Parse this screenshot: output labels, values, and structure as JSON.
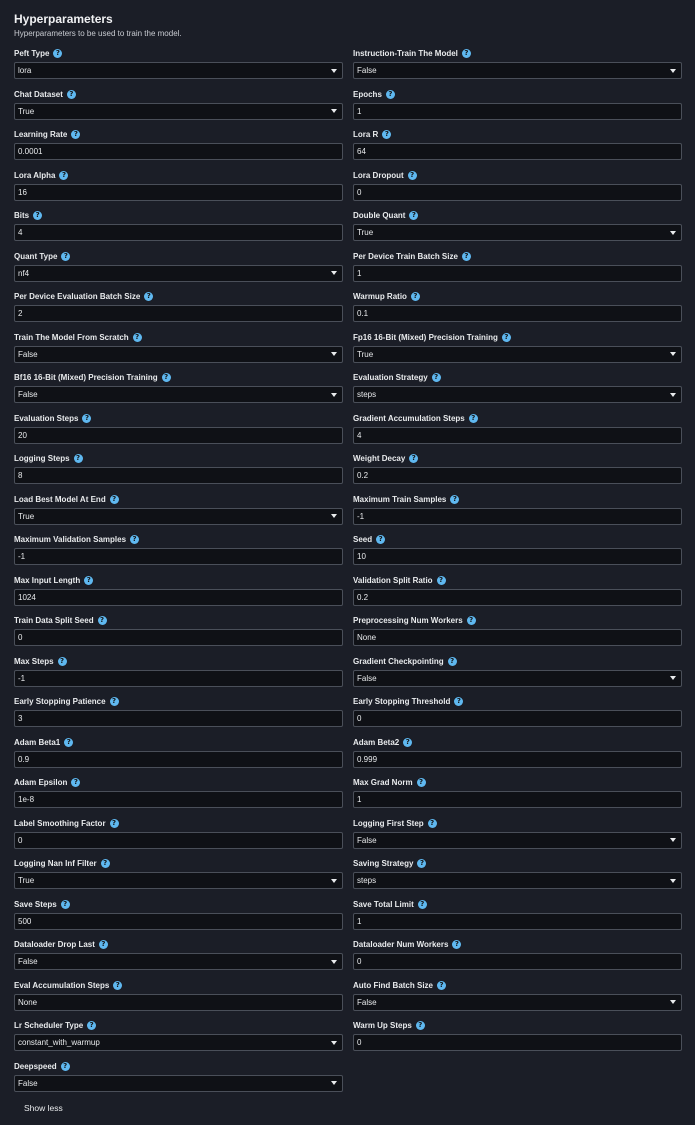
{
  "header": {
    "title": "Hyperparameters",
    "subtitle": "Hyperparameters to be used to train the model."
  },
  "fields": [
    {
      "label": "Peft Type",
      "value": "lora",
      "type": "select"
    },
    {
      "label": "Instruction-Train The Model",
      "value": "False",
      "type": "select"
    },
    {
      "label": "Chat Dataset",
      "value": "True",
      "type": "select"
    },
    {
      "label": "Epochs",
      "value": "1",
      "type": "input"
    },
    {
      "label": "Learning Rate",
      "value": "0.0001",
      "type": "input"
    },
    {
      "label": "Lora R",
      "value": "64",
      "type": "input"
    },
    {
      "label": "Lora Alpha",
      "value": "16",
      "type": "input"
    },
    {
      "label": "Lora Dropout",
      "value": "0",
      "type": "input"
    },
    {
      "label": "Bits",
      "value": "4",
      "type": "input"
    },
    {
      "label": "Double Quant",
      "value": "True",
      "type": "select"
    },
    {
      "label": "Quant Type",
      "value": "nf4",
      "type": "select"
    },
    {
      "label": "Per Device Train Batch Size",
      "value": "1",
      "type": "input"
    },
    {
      "label": "Per Device Evaluation Batch Size",
      "value": "2",
      "type": "input"
    },
    {
      "label": "Warmup Ratio",
      "value": "0.1",
      "type": "input"
    },
    {
      "label": "Train The Model From Scratch",
      "value": "False",
      "type": "select"
    },
    {
      "label": "Fp16 16-Bit (Mixed) Precision Training",
      "value": "True",
      "type": "select"
    },
    {
      "label": "Bf16 16-Bit (Mixed) Precision Training",
      "value": "False",
      "type": "select"
    },
    {
      "label": "Evaluation Strategy",
      "value": "steps",
      "type": "select"
    },
    {
      "label": "Evaluation Steps",
      "value": "20",
      "type": "input"
    },
    {
      "label": "Gradient Accumulation Steps",
      "value": "4",
      "type": "input"
    },
    {
      "label": "Logging Steps",
      "value": "8",
      "type": "input"
    },
    {
      "label": "Weight Decay",
      "value": "0.2",
      "type": "input"
    },
    {
      "label": "Load Best Model At End",
      "value": "True",
      "type": "select"
    },
    {
      "label": "Maximum Train Samples",
      "value": "-1",
      "type": "input"
    },
    {
      "label": "Maximum Validation Samples",
      "value": "-1",
      "type": "input"
    },
    {
      "label": "Seed",
      "value": "10",
      "type": "input"
    },
    {
      "label": "Max Input Length",
      "value": "1024",
      "type": "input"
    },
    {
      "label": "Validation Split Ratio",
      "value": "0.2",
      "type": "input"
    },
    {
      "label": "Train Data Split Seed",
      "value": "0",
      "type": "input"
    },
    {
      "label": "Preprocessing Num Workers",
      "value": "None",
      "type": "input"
    },
    {
      "label": "Max Steps",
      "value": "-1",
      "type": "input"
    },
    {
      "label": "Gradient Checkpointing",
      "value": "False",
      "type": "select"
    },
    {
      "label": "Early Stopping Patience",
      "value": "3",
      "type": "input"
    },
    {
      "label": "Early Stopping Threshold",
      "value": "0",
      "type": "input"
    },
    {
      "label": "Adam Beta1",
      "value": "0.9",
      "type": "input"
    },
    {
      "label": "Adam Beta2",
      "value": "0.999",
      "type": "input"
    },
    {
      "label": "Adam Epsilon",
      "value": "1e-8",
      "type": "input"
    },
    {
      "label": "Max Grad Norm",
      "value": "1",
      "type": "input"
    },
    {
      "label": "Label Smoothing Factor",
      "value": "0",
      "type": "input"
    },
    {
      "label": "Logging First Step",
      "value": "False",
      "type": "select"
    },
    {
      "label": "Logging Nan Inf Filter",
      "value": "True",
      "type": "select"
    },
    {
      "label": "Saving Strategy",
      "value": "steps",
      "type": "select"
    },
    {
      "label": "Save Steps",
      "value": "500",
      "type": "input"
    },
    {
      "label": "Save Total Limit",
      "value": "1",
      "type": "input"
    },
    {
      "label": "Dataloader Drop Last",
      "value": "False",
      "type": "select"
    },
    {
      "label": "Dataloader Num Workers",
      "value": "0",
      "type": "input"
    },
    {
      "label": "Eval Accumulation Steps",
      "value": "None",
      "type": "input"
    },
    {
      "label": "Auto Find Batch Size",
      "value": "False",
      "type": "select"
    },
    {
      "label": "Lr Scheduler Type",
      "value": "constant_with_warmup",
      "type": "select"
    },
    {
      "label": "Warm Up Steps",
      "value": "0",
      "type": "input"
    },
    {
      "label": "Deepspeed",
      "value": "False",
      "type": "select"
    }
  ],
  "footer": {
    "show_less_label": "Show less"
  },
  "icons": {
    "info": "info-icon",
    "dropdown": "chevron-down-icon"
  },
  "colors": {
    "background": "#1b1e27",
    "input_background": "#0f1116",
    "border": "#4a4f59",
    "info_icon": "#5fb8f0",
    "text": "#e9ebed"
  }
}
